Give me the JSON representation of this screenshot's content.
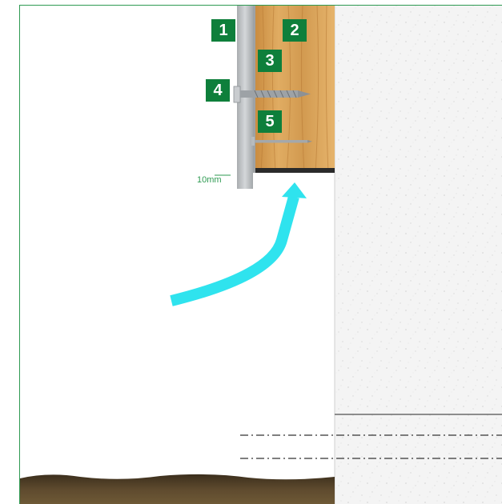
{
  "labels": [
    "1",
    "2",
    "3",
    "4",
    "5"
  ],
  "dimension": {
    "value": "10",
    "unit": "mm"
  },
  "colors": {
    "frame_border": "#2e9a52",
    "label_bg": "#0e7f3b",
    "arrow": "#2fe3ee",
    "wood": "#d8a35c",
    "metal": "#b8bcbf",
    "soil": "#4a3a25"
  }
}
